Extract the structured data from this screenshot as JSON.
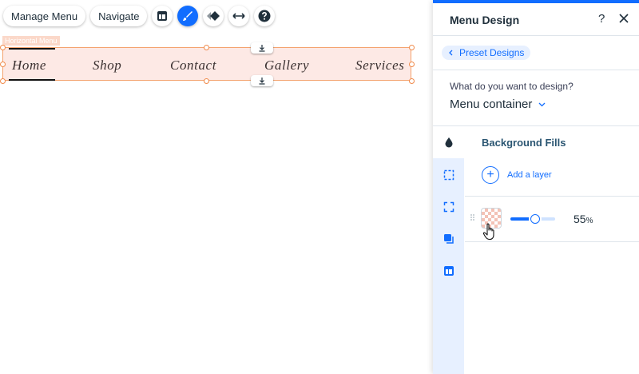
{
  "toolbar": {
    "manage_menu_label": "Manage Menu",
    "navigate_label": "Navigate",
    "icons": [
      "layout-icon",
      "brush-icon",
      "animation-icon",
      "stretch-icon",
      "help-icon"
    ]
  },
  "canvas": {
    "element_tag": "Horizontal Menu",
    "menu_items": [
      "Home",
      "Shop",
      "Contact",
      "Gallery",
      "Services"
    ],
    "selected_item": "Home"
  },
  "panel": {
    "title": "Menu Design",
    "help_label": "?",
    "preset_label": "Preset Designs",
    "question": "What do you want to design?",
    "selected_target": "Menu container",
    "section_title": "Background Fills",
    "add_layer_label": "Add a layer",
    "opacity_value": "55",
    "opacity_unit": "%",
    "opacity_fraction": 0.55
  },
  "colors": {
    "accent": "#116dff",
    "selection_border": "#f4a36e",
    "menu_background": "#fde9e5"
  }
}
